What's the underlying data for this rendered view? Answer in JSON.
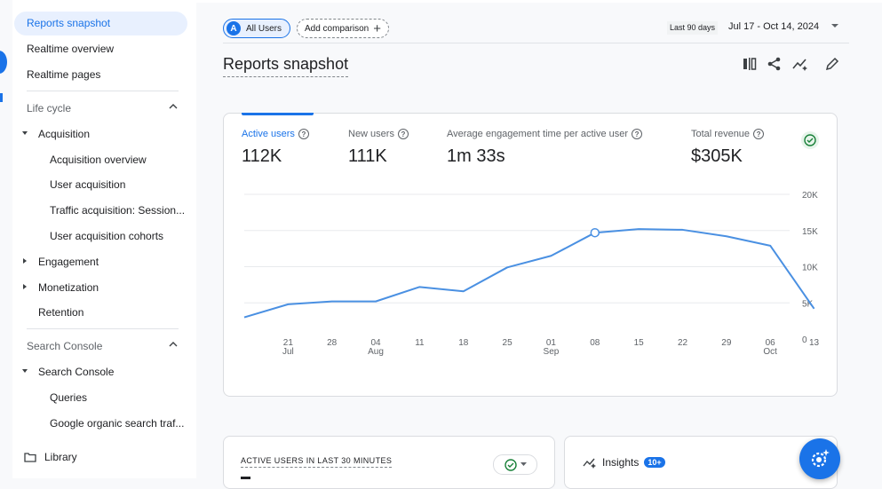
{
  "sidebar": {
    "top_items": [
      "Reports snapshot",
      "Realtime overview",
      "Realtime pages"
    ],
    "lifecycle": {
      "title": "Life cycle",
      "acquisition": {
        "label": "Acquisition",
        "children": [
          "Acquisition overview",
          "User acquisition",
          "Traffic acquisition: Session...",
          "User acquisition cohorts"
        ]
      },
      "engagement": "Engagement",
      "monetization": "Monetization",
      "retention": "Retention"
    },
    "search_console": {
      "title": "Search Console",
      "group": {
        "label": "Search Console",
        "children": [
          "Queries",
          "Google organic search traf..."
        ]
      }
    },
    "library": "Library"
  },
  "toolbar": {
    "users_chip_initial": "A",
    "users_chip_label": "All Users",
    "add_comparison": "Add comparison",
    "date_badge": "Last 90 days",
    "date_range": "Jul 17 - Oct 14, 2024"
  },
  "page_title": "Reports snapshot",
  "metrics": [
    {
      "label": "Active users",
      "value": "112K"
    },
    {
      "label": "New users",
      "value": "111K"
    },
    {
      "label": "Average engagement time per active user",
      "value": "1m 33s"
    },
    {
      "label": "Total revenue",
      "value": "$305K"
    }
  ],
  "chart_data": {
    "type": "line",
    "series": [
      {
        "name": "Active users",
        "values": [
          3000,
          4800,
          5200,
          5200,
          7200,
          6600,
          9900,
          11500,
          14700,
          15200,
          15100,
          14200,
          12900,
          4200
        ]
      }
    ],
    "x": [
      "Jul 17",
      "Jul 21",
      "Jul 28",
      "Aug 04",
      "Aug 11",
      "Aug 18",
      "Aug 25",
      "Sep 01",
      "Sep 08",
      "Sep 15",
      "Sep 22",
      "Sep 29",
      "Oct 06",
      "Oct 13"
    ],
    "x_tick_labels": [
      {
        "day": "21",
        "month": "Jul"
      },
      {
        "day": "28",
        "month": ""
      },
      {
        "day": "04",
        "month": "Aug"
      },
      {
        "day": "11",
        "month": ""
      },
      {
        "day": "18",
        "month": ""
      },
      {
        "day": "25",
        "month": ""
      },
      {
        "day": "01",
        "month": "Sep"
      },
      {
        "day": "08",
        "month": ""
      },
      {
        "day": "15",
        "month": ""
      },
      {
        "day": "22",
        "month": ""
      },
      {
        "day": "29",
        "month": ""
      },
      {
        "day": "06",
        "month": "Oct"
      },
      {
        "day": "13",
        "month": ""
      }
    ],
    "y_tick_labels": [
      "20K",
      "15K",
      "10K",
      "5K",
      "0"
    ],
    "y_ticks": [
      20000,
      15000,
      10000,
      5000,
      0
    ],
    "ylim": [
      0,
      20000
    ],
    "highlight_date": "Sep 08",
    "grid": true,
    "color": "#4a90e2"
  },
  "realtime_card": {
    "title": "ACTIVE USERS IN LAST 30 MINUTES"
  },
  "insights_card": {
    "title": "Insights",
    "badge": "10+"
  },
  "colors": {
    "accent": "#1a73e8",
    "success": "#188038"
  }
}
